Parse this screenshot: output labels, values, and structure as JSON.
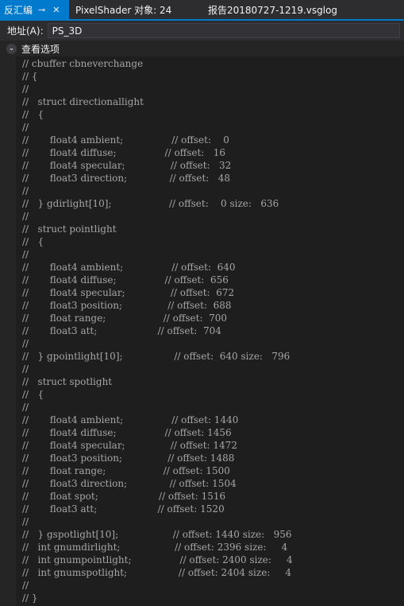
{
  "tabs": [
    {
      "label": "反汇编",
      "pin_icon": "pin-icon",
      "close_icon": "close-icon"
    },
    {
      "label": "PixelShader 对象: 24"
    },
    {
      "label": "报告20180727-1219.vsglog"
    }
  ],
  "address": {
    "label": "地址(A):",
    "value": "PS_3D"
  },
  "options": {
    "label": "查看选项",
    "icon": "chevron-down-icon"
  },
  "colors": {
    "accent": "#007acc",
    "background": "#1e1e1e",
    "code_text": "#a6a6a6"
  },
  "code_lines": [
    "// cbuffer cbneverchange",
    "// {",
    "//",
    "//   struct directionallight",
    "//   {",
    "//",
    "//       float4 ambient;                // offset:    0",
    "//       float4 diffuse;                // offset:   16",
    "//       float4 specular;               // offset:   32",
    "//       float3 direction;              // offset:   48",
    "//",
    "//   } gdirlight[10];                   // offset:    0 size:   636",
    "//",
    "//   struct pointlight",
    "//   {",
    "//",
    "//       float4 ambient;                // offset:  640",
    "//       float4 diffuse;                // offset:  656",
    "//       float4 specular;               // offset:  672",
    "//       float3 position;               // offset:  688",
    "//       float range;                   // offset:  700",
    "//       float3 att;                    // offset:  704",
    "//",
    "//   } gpointlight[10];                 // offset:  640 size:   796",
    "//",
    "//   struct spotlight",
    "//   {",
    "//",
    "//       float4 ambient;                // offset: 1440",
    "//       float4 diffuse;                // offset: 1456",
    "//       float4 specular;               // offset: 1472",
    "//       float3 position;               // offset: 1488",
    "//       float range;                   // offset: 1500",
    "//       float3 direction;              // offset: 1504",
    "//       float spot;                    // offset: 1516",
    "//       float3 att;                    // offset: 1520",
    "//",
    "//   } gspotlight[10];                  // offset: 1440 size:   956",
    "//   int gnumdirlight;                  // offset: 2396 size:     4",
    "//   int gnumpointlight;                // offset: 2400 size:     4",
    "//   int gnumspotlight;                 // offset: 2404 size:     4",
    "//",
    "// }"
  ]
}
